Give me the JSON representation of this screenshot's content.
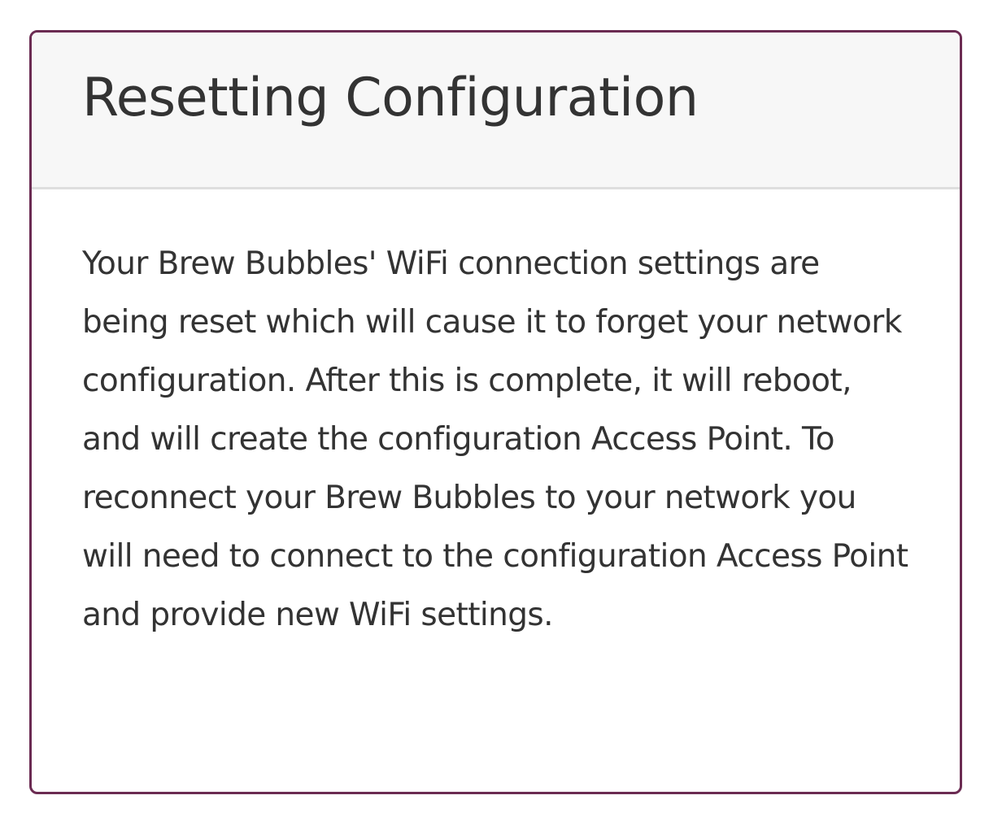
{
  "card": {
    "title": "Resetting Configuration",
    "body": "Your Brew Bubbles' WiFi connection settings are being reset which will cause it to forget your network configuration. After this is complete, it will reboot, and will create the configuration Access Point. To reconnect your Brew Bubbles to your network you will need to connect to the configuration Access Point and provide new WiFi settings."
  },
  "colors": {
    "border": "#6b2b52",
    "header_background": "#f7f7f7",
    "text": "#333333"
  }
}
